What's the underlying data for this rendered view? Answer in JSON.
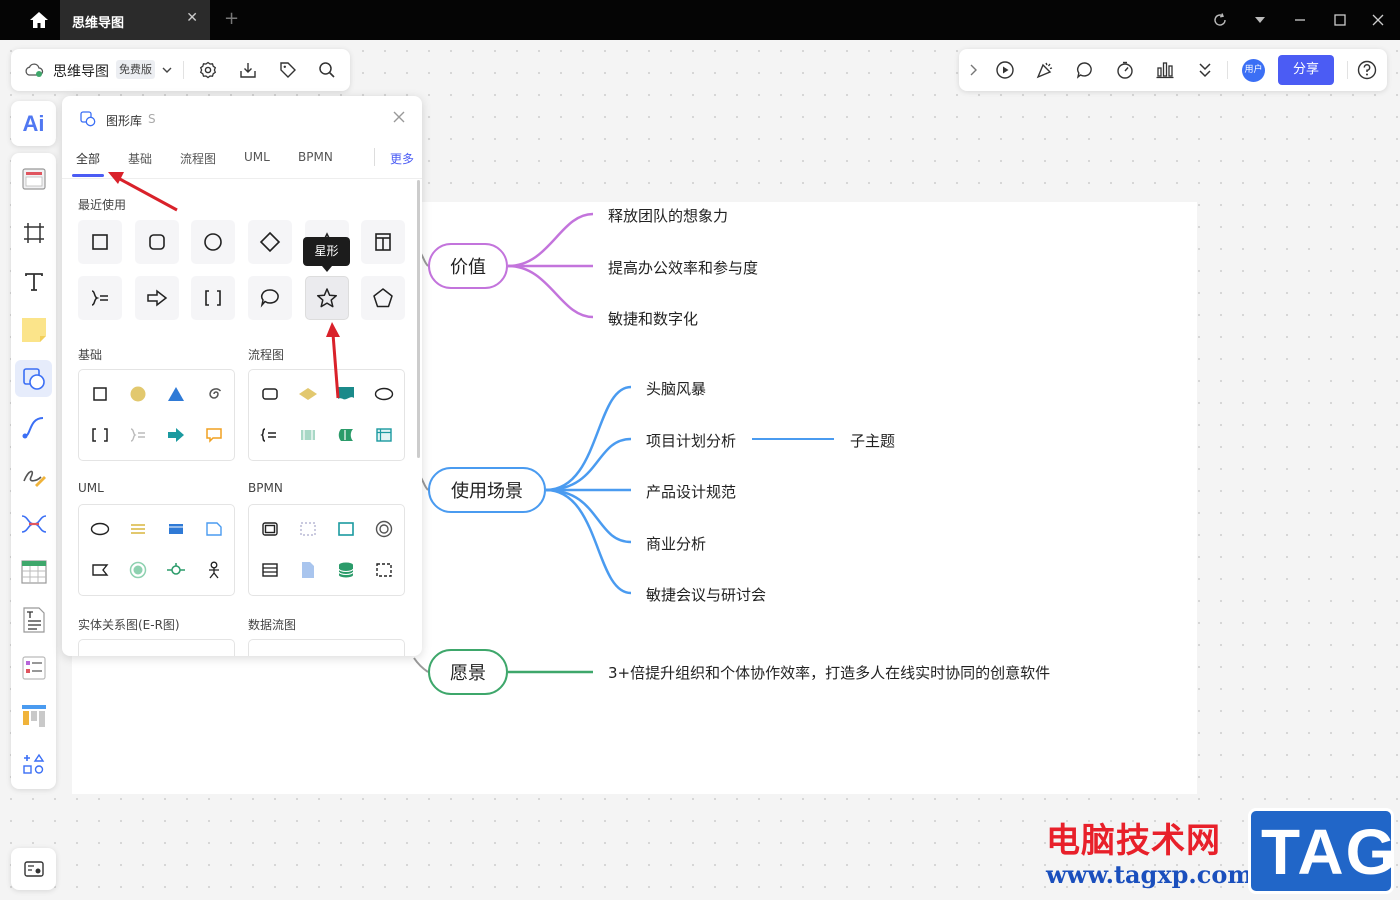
{
  "titlebar": {
    "tab_label": "思维导图",
    "close_glyph": "✕",
    "new_tab_glyph": "+"
  },
  "topbar": {
    "file_name": "思维导图",
    "plan_badge": "免费版",
    "avatar_text": "用户",
    "share_label": "分享",
    "icons": [
      "cloud-sync-icon",
      "chevron-down-icon",
      "settings-icon",
      "download-icon",
      "tag-icon",
      "search-icon",
      "expand-icon",
      "play-icon",
      "celebrate-icon",
      "comment-icon",
      "timer-icon",
      "vote-icon",
      "more-icon",
      "help-icon"
    ]
  },
  "left_toolbar": {
    "ai_label": "Ai",
    "tools": [
      "template-icon",
      "frame-icon",
      "text-icon",
      "sticky-note-icon",
      "shape-icon",
      "connector-icon",
      "pen-icon",
      "mindmap-icon",
      "table-icon",
      "document-icon",
      "list-icon",
      "kanban-icon",
      "more-tools-icon"
    ],
    "bottom": "map-icon"
  },
  "shape_library": {
    "title": "图形库",
    "shortcut": "S",
    "tabs": [
      "全部",
      "基础",
      "流程图",
      "UML",
      "BPMN"
    ],
    "active_tab": "全部",
    "more_label": "更多",
    "recent_label": "最近使用",
    "tooltip": "星形",
    "sections": {
      "basic": "基础",
      "flowchart": "流程图",
      "uml": "UML",
      "bpmn": "BPMN",
      "er": "实体关系图(E-R图)",
      "dfd": "数据流图"
    }
  },
  "mindmap": {
    "nodes": [
      {
        "label": "价值",
        "color": "#b765d8",
        "children": [
          "释放团队的想象力",
          "提高办公效率和参与度",
          "敏捷和数字化"
        ]
      },
      {
        "label": "使用场景",
        "color": "#4a9bf0",
        "children": [
          "头脑风暴",
          "项目计划分析",
          "产品设计规范",
          "商业分析",
          "敏捷会议与研讨会"
        ],
        "sub_child": "子主题"
      },
      {
        "label": "愿景",
        "color": "#3ea76b",
        "children": [
          "3+倍提升组织和个体协作效率，打造多人在线实时协同的创意软件"
        ]
      }
    ]
  },
  "watermark": {
    "cn": "电脑技术网",
    "url": "www.tagxp.com",
    "tag": "TAG"
  }
}
